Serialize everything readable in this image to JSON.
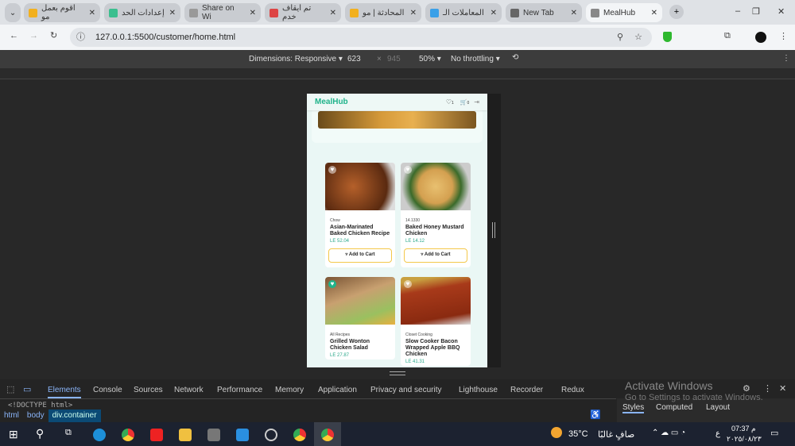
{
  "browser": {
    "tabs": [
      {
        "title": "اقوم بعمل مو",
        "color": "#f2b01e"
      },
      {
        "title": "إعدادات الحد",
        "color": "#3bbf8f"
      },
      {
        "title": "Share on Wi",
        "color": "#999"
      },
      {
        "title": "تم ايقاف خدم",
        "color": "#d44"
      },
      {
        "title": "المحادثة | مو",
        "color": "#f2b01e"
      },
      {
        "title": "المعاملات الـ",
        "color": "#3aa0e8"
      },
      {
        "title": "New Tab",
        "color": "#666"
      },
      {
        "title": "MealHub",
        "color": "#888"
      }
    ],
    "url": "127.0.0.1:5500/customer/home.html"
  },
  "devtools": {
    "dimensions": "Dimensions: Responsive ▾",
    "width": "623",
    "x": "×",
    "height": "945",
    "zoom": "50% ▾",
    "throttling": "No throttling ▾",
    "tabs": [
      "Elements",
      "Console",
      "Sources",
      "Network",
      "Performance",
      "Memory",
      "Application",
      "Privacy and security",
      "Lighthouse",
      "Recorder",
      "Redux"
    ],
    "doctype": "<!DOCTYPE html>",
    "breadcrumbs": [
      "html",
      "body",
      "div.container"
    ],
    "side_tabs": [
      "Styles",
      "Computed",
      "Layout"
    ],
    "watermark_title": "Activate Windows",
    "watermark_sub": "Go to Settings to activate Windows."
  },
  "app": {
    "logo": "MealHub",
    "fav_count": "1",
    "cart_count": "0",
    "add_label": "Add to Cart",
    "cards": [
      {
        "category": "Chow",
        "name": "Asian-Marinated Baked Chicken Recipe",
        "price": "LE 52.04",
        "fav": false
      },
      {
        "category": "14.1330",
        "name": "Baked Honey Mustard Chicken",
        "price": "LE 14.12",
        "fav": false
      },
      {
        "category": "All Recipes",
        "name": "Grilled Wonton Chicken Salad",
        "price": "LE 27.87",
        "fav": true
      },
      {
        "category": "Closet Cooking",
        "name": "Slow Cooker Bacon Wrapped Apple BBQ Chicken",
        "price": "LE 41.31",
        "fav": false
      }
    ]
  },
  "taskbar": {
    "temp": "35°C",
    "weather": "صافٍ غالبًا",
    "time": "07:37 م",
    "date": "٢٠٢٥/٠٨/٢٣",
    "lang": "ع"
  }
}
